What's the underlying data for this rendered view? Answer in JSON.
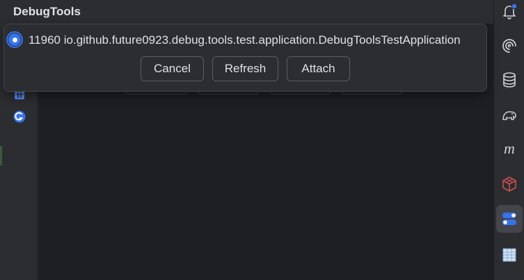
{
  "tool_window": {
    "title": "DebugTools"
  },
  "dialog": {
    "process_item": "11960 io.github.future0923.debug.tools.test.application.DebugToolsTestApplication",
    "buttons": {
      "cancel": "Cancel",
      "refresh": "Refresh",
      "attach": "Attach"
    }
  },
  "left_toolbar": {
    "icons": [
      "table-icon",
      "debugtools-logo-icon"
    ]
  },
  "right_toolbar": {
    "icons": [
      "notifications-icon",
      "ai-assistant-icon",
      "database-icon",
      "gradle-elephant-icon",
      "maven-icon",
      "cube-icon",
      "debugtools-toggle-icon",
      "spreadsheet-icon"
    ],
    "active": "debugtools-toggle-icon"
  },
  "colors": {
    "accent": "#3574f0",
    "background": "#2b2d30",
    "notification_badge": "#3574f0"
  }
}
